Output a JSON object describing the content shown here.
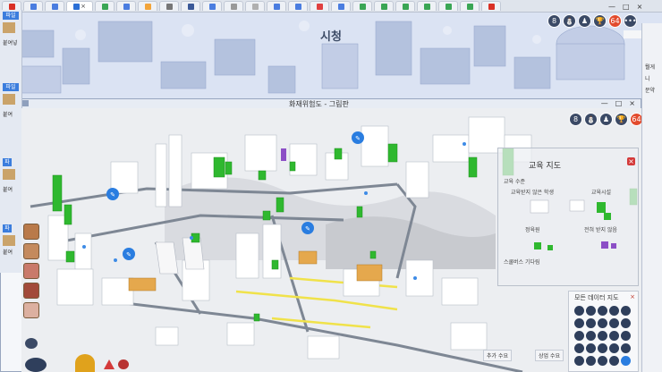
{
  "browser": {
    "tabs": [
      {
        "icon": "youtube-icon",
        "color": "#d93025"
      },
      {
        "icon": "google-icon",
        "color": "#4a7de0"
      },
      {
        "icon": "google-icon",
        "color": "#4a7de0"
      },
      {
        "icon": "simcity-icon",
        "color": "#2b6fd6",
        "active": true
      },
      {
        "icon": "page-icon",
        "color": "#3aa655"
      },
      {
        "icon": "google-icon",
        "color": "#4a7de0"
      },
      {
        "icon": "page-icon",
        "color": "#f2a43a"
      },
      {
        "icon": "page-icon",
        "color": "#777777"
      },
      {
        "icon": "facebook-icon",
        "color": "#3b5998"
      },
      {
        "icon": "google-icon",
        "color": "#4a7de0"
      },
      {
        "icon": "page-icon",
        "color": "#999999"
      },
      {
        "icon": "page-icon",
        "color": "#b0b0b0"
      },
      {
        "icon": "google-icon",
        "color": "#4a7de0"
      },
      {
        "icon": "google-icon",
        "color": "#4a7de0"
      },
      {
        "icon": "blogger-icon",
        "color": "#e04040"
      },
      {
        "icon": "google-icon",
        "color": "#4a7de0"
      },
      {
        "icon": "page-icon",
        "color": "#3aa655"
      },
      {
        "icon": "page-icon",
        "color": "#3aa655"
      },
      {
        "icon": "page-icon",
        "color": "#3aa655"
      },
      {
        "icon": "page-icon",
        "color": "#3aa655"
      },
      {
        "icon": "page-icon",
        "color": "#3aa655"
      },
      {
        "icon": "page-icon",
        "color": "#3aa655"
      },
      {
        "icon": "youtube-icon",
        "color": "#d93025"
      }
    ],
    "tab_close": "×",
    "win_min": "—",
    "win_max": "□",
    "win_close": "×"
  },
  "back_window": {
    "title": "시청",
    "bookmark_label": "북마크",
    "side_labels": [
      "뭘게",
      "니",
      "문약"
    ]
  },
  "paint": {
    "title": "화재위험도 - 그림판",
    "side": {
      "file_tab": "파일",
      "paste": "붙여넣",
      "file_tab2": "파일",
      "paste2": "붙여",
      "file_tab3": "파",
      "paste3": "붙여",
      "file_tab4": "파",
      "paste4": "붙여"
    }
  },
  "game": {
    "top_icons": [
      "8",
      "⛄",
      "♟",
      "🏆",
      "64",
      "•••"
    ],
    "edu_panel": {
      "title": "교육 지도",
      "close": "×",
      "labels": {
        "level": "교육 수준",
        "high_school": "교육받지 않은 학생",
        "edu_facility": "교육시설",
        "unemployed": "전혀 받지 않음",
        "school_bus": "스쿨버스 기다림",
        "student": "학생 수",
        "education_box": "정육원"
      }
    },
    "data_panel": {
      "title": "모든 데이터 지도",
      "close": "×"
    },
    "bottom": {
      "supply": "추가 수요",
      "commerce": "상업 수요"
    },
    "colors": {
      "accent_green": "#2fb82f",
      "hotspot_blue": "#2a7de0",
      "road_yellow": "#f0e24a",
      "icon_dark": "#2f3f5c"
    }
  }
}
